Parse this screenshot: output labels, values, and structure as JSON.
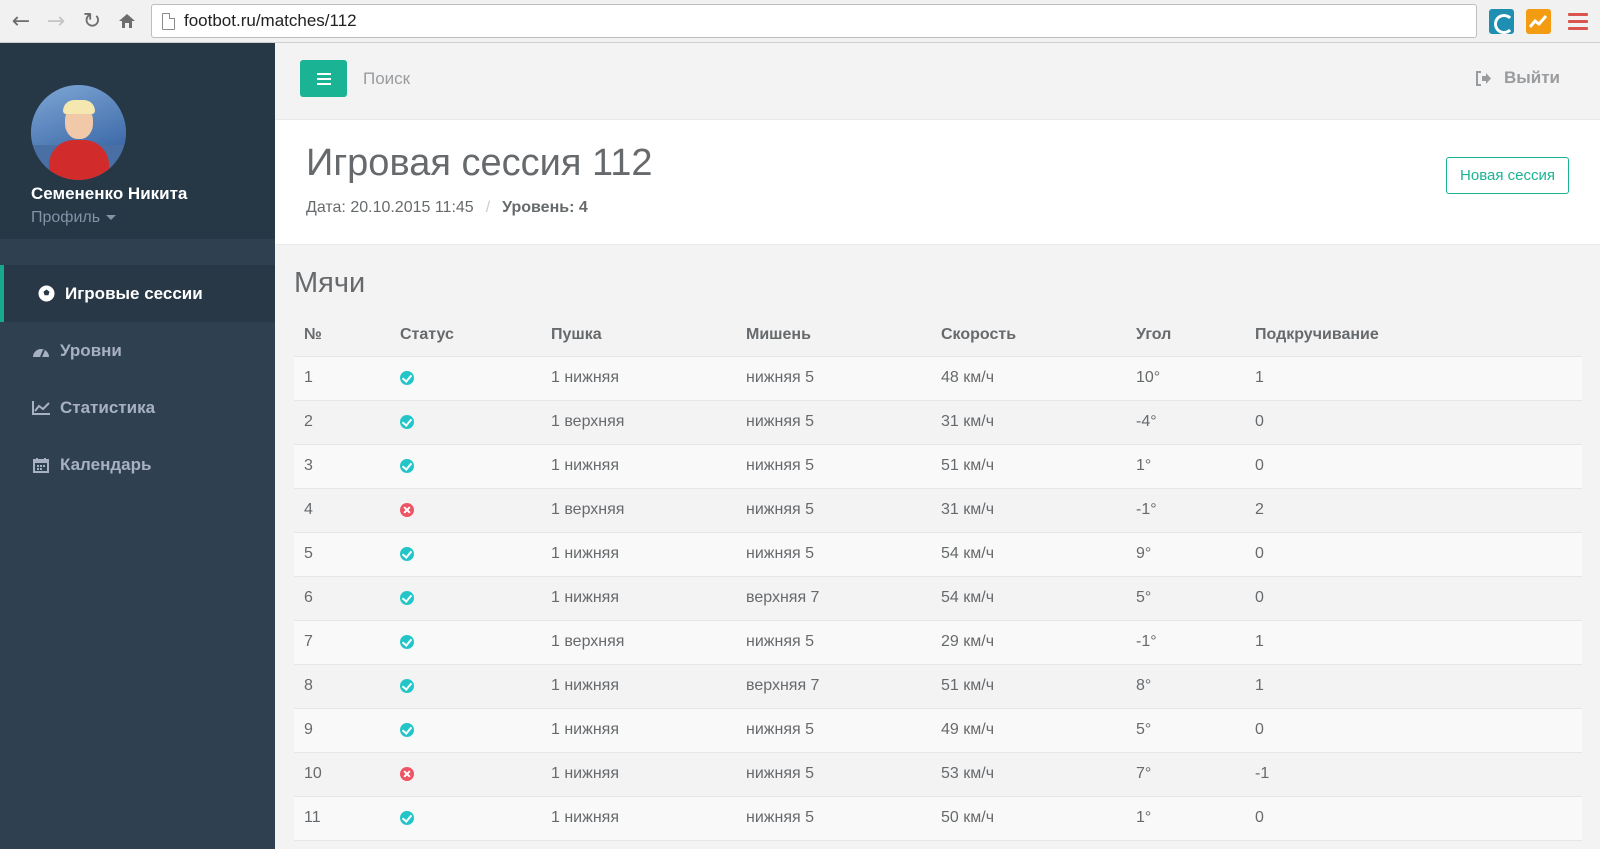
{
  "browser": {
    "url": "footbot.ru/matches/112"
  },
  "sidebar": {
    "profile": {
      "name": "Семененко Никита",
      "link": "Профиль"
    },
    "items": [
      {
        "label": "Игровые сессии",
        "icon": "soccer-ball-icon",
        "active": true
      },
      {
        "label": "Уровни",
        "icon": "dashboard-icon",
        "active": false
      },
      {
        "label": "Статистика",
        "icon": "line-chart-icon",
        "active": false
      },
      {
        "label": "Календарь",
        "icon": "calendar-icon",
        "active": false
      }
    ]
  },
  "topbar": {
    "search_placeholder": "Поиск",
    "logout_label": "Выйти"
  },
  "heading": {
    "title": "Игровая сессия 112",
    "date_text": "Дата: 20.10.2015 11:45",
    "separator": "/",
    "level_text": "Уровень: 4",
    "new_session_label": "Новая сессия"
  },
  "balls": {
    "title": "Мячи",
    "columns": [
      "№",
      "Статус",
      "Пушка",
      "Мишень",
      "Скорость",
      "Угол",
      "Подкручивание"
    ],
    "rows": [
      {
        "num": "1",
        "status": "ok",
        "cannon": "1 нижняя",
        "target": "нижняя 5",
        "speed": "48 км/ч",
        "angle": "10°",
        "spin": "1"
      },
      {
        "num": "2",
        "status": "ok",
        "cannon": "1 верхняя",
        "target": "нижняя 5",
        "speed": "31 км/ч",
        "angle": "-4°",
        "spin": "0"
      },
      {
        "num": "3",
        "status": "ok",
        "cannon": "1 нижняя",
        "target": "нижняя 5",
        "speed": "51 км/ч",
        "angle": "1°",
        "spin": "0"
      },
      {
        "num": "4",
        "status": "error",
        "cannon": "1 верхняя",
        "target": "нижняя 5",
        "speed": "31 км/ч",
        "angle": "-1°",
        "spin": "2"
      },
      {
        "num": "5",
        "status": "ok",
        "cannon": "1 нижняя",
        "target": "нижняя 5",
        "speed": "54 км/ч",
        "angle": "9°",
        "spin": "0"
      },
      {
        "num": "6",
        "status": "ok",
        "cannon": "1 нижняя",
        "target": "верхняя 7",
        "speed": "54 км/ч",
        "angle": "5°",
        "spin": "0"
      },
      {
        "num": "7",
        "status": "ok",
        "cannon": "1 верхняя",
        "target": "нижняя 5",
        "speed": "29 км/ч",
        "angle": "-1°",
        "spin": "1"
      },
      {
        "num": "8",
        "status": "ok",
        "cannon": "1 нижняя",
        "target": "верхняя 7",
        "speed": "51 км/ч",
        "angle": "8°",
        "spin": "1"
      },
      {
        "num": "9",
        "status": "ok",
        "cannon": "1 нижняя",
        "target": "нижняя 5",
        "speed": "49 км/ч",
        "angle": "5°",
        "spin": "0"
      },
      {
        "num": "10",
        "status": "error",
        "cannon": "1 нижняя",
        "target": "нижняя 5",
        "speed": "53 км/ч",
        "angle": "7°",
        "spin": "-1"
      },
      {
        "num": "11",
        "status": "ok",
        "cannon": "1 нижняя",
        "target": "нижняя 5",
        "speed": "50 км/ч",
        "angle": "1°",
        "spin": "0"
      }
    ]
  },
  "colors": {
    "accent": "#1ab394",
    "sidebar": "#2f4050",
    "status_ok": "#23c6c8",
    "status_error": "#ed5565"
  }
}
